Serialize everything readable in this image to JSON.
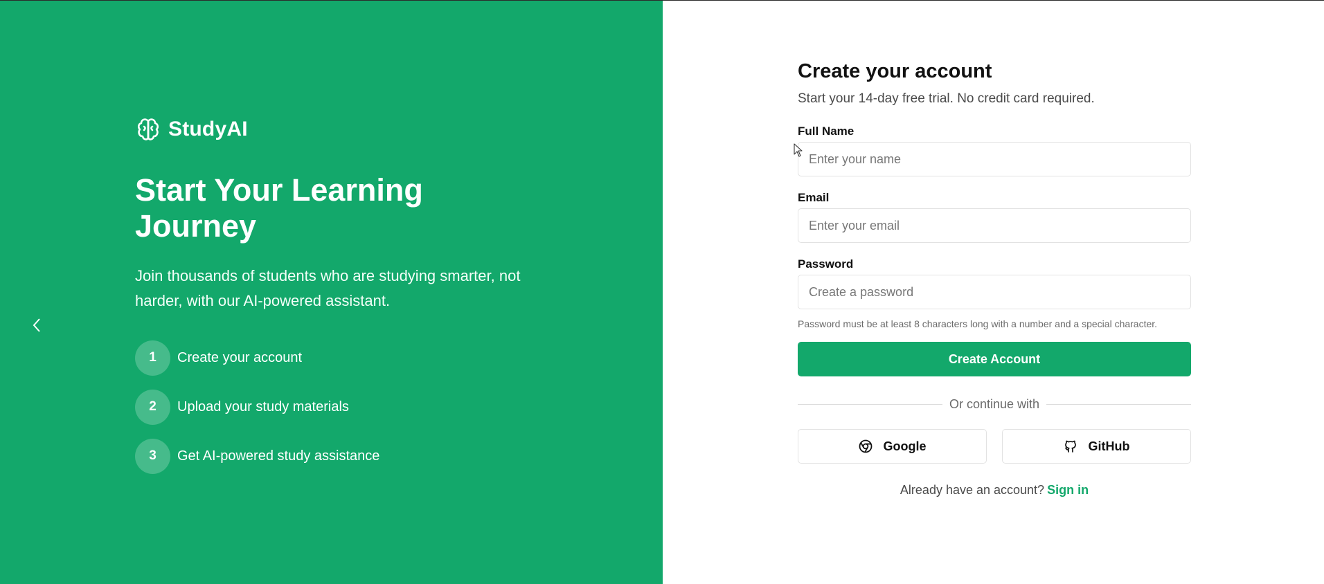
{
  "brand": {
    "name": "StudyAI",
    "icon": "brain-icon"
  },
  "hero": {
    "title": "Start Your Learning Journey",
    "subtitle": "Join thousands of students who are studying smarter, not harder, with our AI-powered assistant."
  },
  "steps": [
    {
      "number": "1",
      "label": "Create your account"
    },
    {
      "number": "2",
      "label": "Upload your study materials"
    },
    {
      "number": "3",
      "label": "Get AI-powered study assistance"
    }
  ],
  "form": {
    "title": "Create your account",
    "subtitle": "Start your 14-day free trial. No credit card required.",
    "full_name": {
      "label": "Full Name",
      "placeholder": "Enter your name"
    },
    "email": {
      "label": "Email",
      "placeholder": "Enter your email"
    },
    "password": {
      "label": "Password",
      "placeholder": "Create a password",
      "hint": "Password must be at least 8 characters long with a number and a special character."
    },
    "submit_label": "Create Account",
    "divider_text": "Or continue with",
    "google_label": "Google",
    "github_label": "GitHub",
    "signin_prompt": "Already have an account?",
    "signin_link": "Sign in"
  },
  "colors": {
    "accent": "#13a86b",
    "text": "#111111",
    "muted": "#6b6b6b"
  }
}
